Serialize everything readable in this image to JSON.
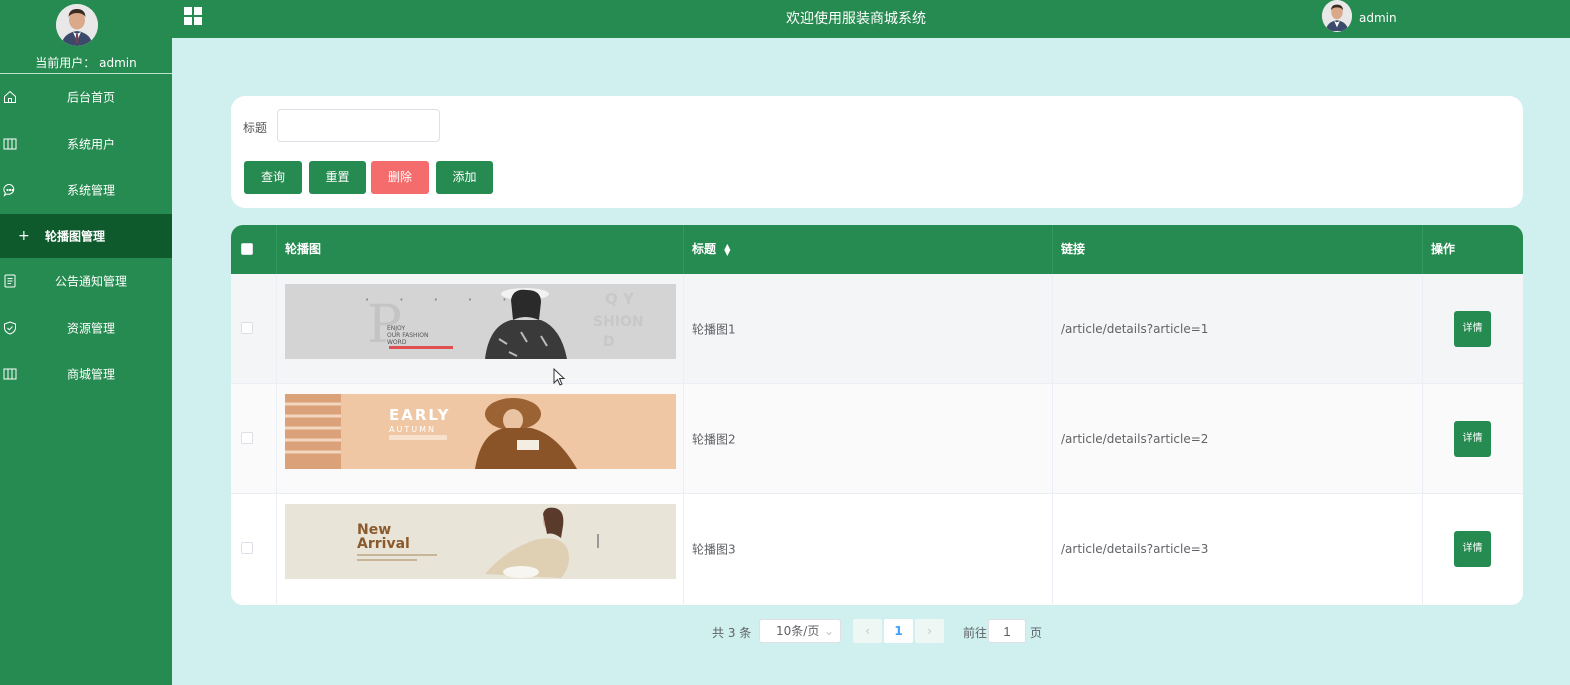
{
  "header": {
    "title": "欢迎使用服装商城系统",
    "username": "admin"
  },
  "sidebar": {
    "current_user_label": "当前用户：",
    "current_user": "admin",
    "items": [
      {
        "label": "后台首页",
        "icon": "home-icon"
      },
      {
        "label": "系统用户",
        "icon": "columns-icon"
      },
      {
        "label": "系统管理",
        "icon": "chat-icon"
      },
      {
        "label": "轮播图管理",
        "icon": "plus-icon",
        "active": true
      },
      {
        "label": "公告通知管理",
        "icon": "document-icon"
      },
      {
        "label": "资源管理",
        "icon": "shield-icon"
      },
      {
        "label": "商城管理",
        "icon": "columns-icon"
      }
    ]
  },
  "search": {
    "title_label": "标题",
    "title_value": "",
    "buttons": {
      "query": "查询",
      "reset": "重置",
      "delete": "删除",
      "add": "添加"
    }
  },
  "table": {
    "headers": {
      "image": "轮播图",
      "title": "标题",
      "link": "链接",
      "action": "操作"
    },
    "rows": [
      {
        "title": "轮播图1",
        "link": "/article/details?article=1",
        "action": "详情",
        "banner_text": [
          "ENJOY",
          "OUR FASHION",
          "WORD"
        ]
      },
      {
        "title": "轮播图2",
        "link": "/article/details?article=2",
        "action": "详情",
        "banner_text": [
          "EARLY",
          "AUTUMN"
        ]
      },
      {
        "title": "轮播图3",
        "link": "/article/details?article=3",
        "action": "详情",
        "banner_text": [
          "New",
          "Arrival"
        ]
      }
    ]
  },
  "pagination": {
    "total": "共 3 条",
    "page_size": "10条/页",
    "current_page": "1",
    "goto_label": "前往",
    "goto_value": "1",
    "page_suffix": "页"
  },
  "colors": {
    "primary": "#268b50",
    "primary_dark": "#0e5a2c",
    "danger": "#f56c6c",
    "background": "#cff0ee"
  }
}
